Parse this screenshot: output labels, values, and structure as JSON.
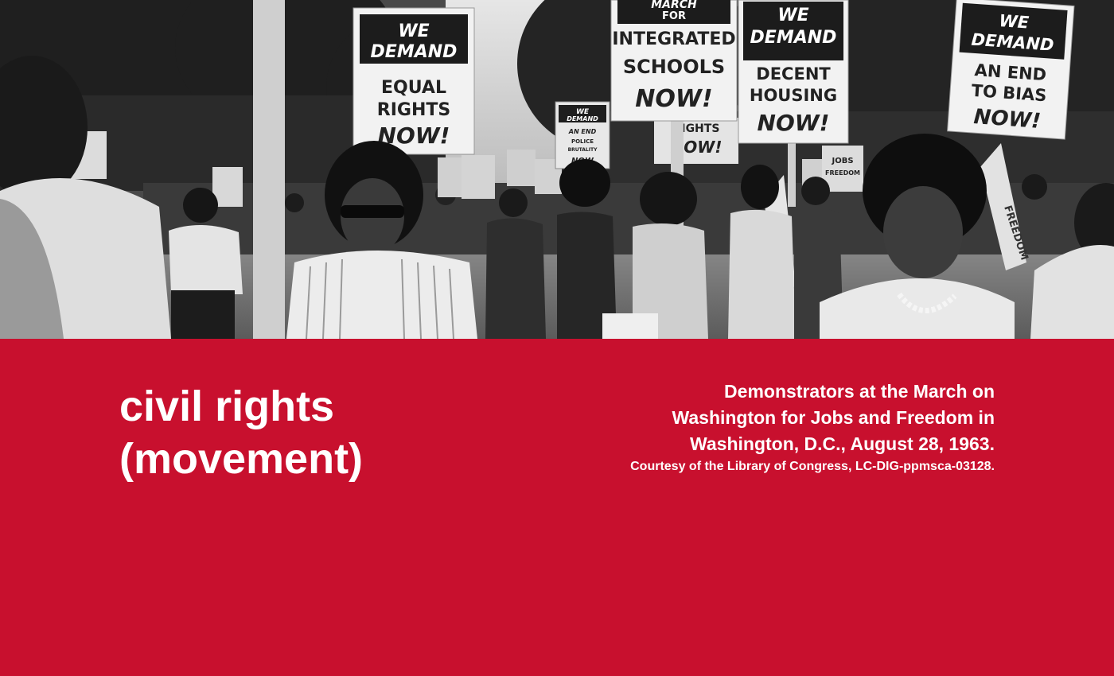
{
  "photo": {
    "signs": {
      "equal_rights": [
        "WE",
        "DEMAND",
        "EQUAL",
        "RIGHTS",
        "NOW!"
      ],
      "integrated_schools": [
        "MARCH",
        "FOR",
        "INTEGRATED",
        "SCHOOLS",
        "NOW!"
      ],
      "decent_housing": [
        "WE",
        "DEMAND",
        "DECENT",
        "HOUSING",
        "NOW!"
      ],
      "end_to_bias": [
        "WE",
        "DEMAND",
        "AN END",
        "TO BIAS",
        "NOW!"
      ],
      "police_brutality": [
        "WE",
        "DEMAND",
        "AN END",
        "POLICE",
        "BRUTALITY",
        "NOW"
      ],
      "rights_now": [
        "RIGHTS",
        "NOW!"
      ],
      "jobs_freedom": [
        "JOBS",
        "FREEDOM"
      ],
      "freedom_banner": "FREEDOM"
    }
  },
  "panel": {
    "title_line1": "civil rights",
    "title_line2": "(movement)",
    "caption_line1": "Demonstrators at the March on",
    "caption_line2": "Washington for Jobs and Freedom in",
    "caption_line3": "Washington, D.C., August 28, 1963.",
    "credit": "Courtesy of the Library of Congress, LC-DIG-ppmsca-03128."
  },
  "colors": {
    "brand_red": "#c8102e",
    "text": "#ffffff"
  }
}
